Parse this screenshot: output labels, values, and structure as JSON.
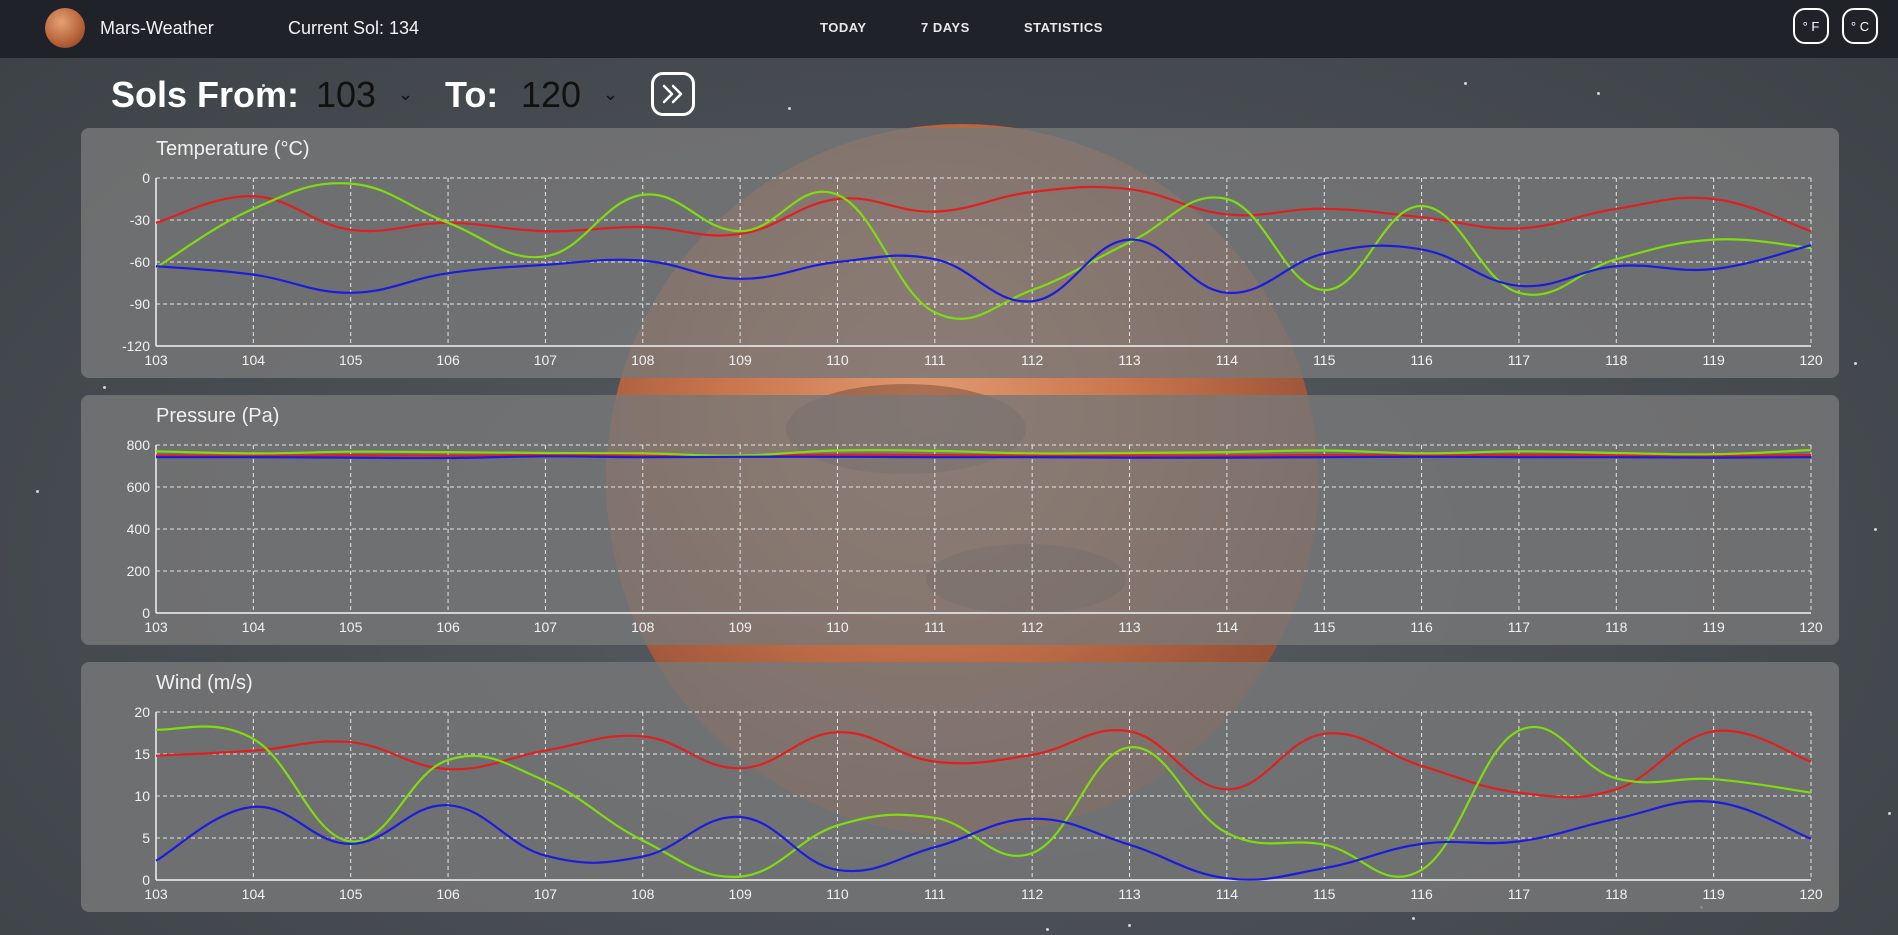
{
  "header": {
    "brand": "Mars-Weather",
    "current_sol": "Current Sol: 134",
    "nav": [
      {
        "label": "TODAY"
      },
      {
        "label": "7 DAYS"
      },
      {
        "label": "STATISTICS"
      }
    ],
    "unit_f": "° F",
    "unit_c": "° C"
  },
  "range": {
    "from_label": "Sols From:",
    "from_value": "103",
    "to_label": "To:",
    "to_value": "120"
  },
  "colors": {
    "max": "#e02020",
    "avg": "#7fdc10",
    "min": "#1c1cdc"
  },
  "chart_data": [
    {
      "type": "line",
      "title": "Temperature (°C)",
      "x": [
        103,
        104,
        105,
        106,
        107,
        108,
        109,
        110,
        111,
        112,
        113,
        114,
        115,
        116,
        117,
        118,
        119,
        120
      ],
      "ylim": [
        -120,
        0
      ],
      "yticks": [
        0,
        -30,
        -60,
        -90,
        -120
      ],
      "grid": true,
      "series": [
        {
          "values": [
            -32,
            -13,
            -37,
            -32,
            -38,
            -35,
            -40,
            -15,
            -24,
            -10,
            -8,
            -26,
            -22,
            -28,
            -36,
            -22,
            -15,
            -38
          ]
        },
        {
          "values": [
            -64,
            -22,
            -4,
            -32,
            -56,
            -12,
            -38,
            -12,
            -96,
            -80,
            -46,
            -15,
            -80,
            -20,
            -82,
            -58,
            -44,
            -50
          ]
        },
        {
          "values": [
            -63,
            -69,
            -82,
            -68,
            -62,
            -59,
            -72,
            -60,
            -58,
            -88,
            -44,
            -82,
            -54,
            -51,
            -77,
            -63,
            -65,
            -48
          ]
        }
      ]
    },
    {
      "type": "line",
      "title": "Pressure (Pa)",
      "x": [
        103,
        104,
        105,
        106,
        107,
        108,
        109,
        110,
        111,
        112,
        113,
        114,
        115,
        116,
        117,
        118,
        119,
        120
      ],
      "ylim": [
        0,
        800
      ],
      "yticks": [
        800,
        600,
        400,
        200,
        0
      ],
      "grid": true,
      "series": [
        {
          "values": [
            750,
            748,
            752,
            749,
            753,
            751,
            750,
            754,
            752,
            750,
            751,
            749,
            752,
            750,
            753,
            751,
            749,
            752
          ]
        },
        {
          "values": [
            770,
            760,
            768,
            766,
            762,
            760,
            750,
            774,
            772,
            760,
            762,
            766,
            774,
            760,
            770,
            762,
            756,
            776
          ]
        },
        {
          "values": [
            742,
            742,
            740,
            738,
            746,
            742,
            744,
            744,
            742,
            742,
            740,
            740,
            742,
            744,
            742,
            742,
            740,
            742
          ]
        }
      ]
    },
    {
      "type": "line",
      "title": "Wind (m/s)",
      "x": [
        103,
        104,
        105,
        106,
        107,
        108,
        109,
        110,
        111,
        112,
        113,
        114,
        115,
        116,
        117,
        118,
        119,
        120
      ],
      "ylim": [
        0,
        20
      ],
      "yticks": [
        20,
        15,
        10,
        5,
        0
      ],
      "grid": true,
      "series": [
        {
          "values": [
            14.8,
            15.4,
            16.4,
            13.2,
            15.4,
            17.1,
            13.3,
            17.6,
            14.1,
            14.9,
            17.7,
            10.8,
            17.4,
            13.6,
            10.4,
            10.8,
            17.7,
            14.1
          ]
        },
        {
          "values": [
            17.9,
            16.8,
            4.6,
            14.3,
            11.8,
            4.7,
            0.4,
            6.5,
            7.4,
            3.2,
            15.8,
            5.6,
            4.2,
            1.2,
            17.8,
            12.1,
            12.0,
            10.4
          ]
        },
        {
          "values": [
            2.3,
            8.7,
            4.3,
            8.9,
            2.9,
            2.8,
            7.5,
            1.2,
            3.9,
            7.3,
            4.2,
            0.2,
            1.4,
            4.3,
            4.6,
            7.3,
            9.3,
            4.9
          ]
        }
      ]
    }
  ]
}
